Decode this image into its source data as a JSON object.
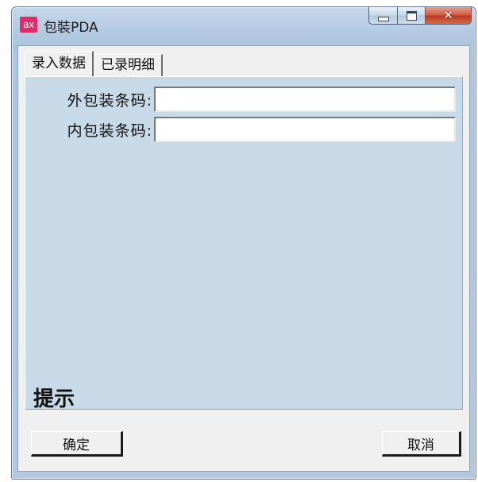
{
  "window": {
    "icon_text": "ax",
    "title": "包裝PDA",
    "close_glyph": "✕"
  },
  "tabs": [
    {
      "label": "录入数据",
      "active": true
    },
    {
      "label": "已录明细",
      "active": false
    }
  ],
  "form": {
    "outer_label": "外包装条码:",
    "outer_value": "",
    "inner_label": "内包装条码:",
    "inner_value": ""
  },
  "hint": "提示",
  "buttons": {
    "ok": "确定",
    "cancel": "取消"
  },
  "colors": {
    "panel_bg": "#c8d9e8",
    "app_icon_bg": "#e32a6a",
    "close_button": "#c8462b"
  }
}
